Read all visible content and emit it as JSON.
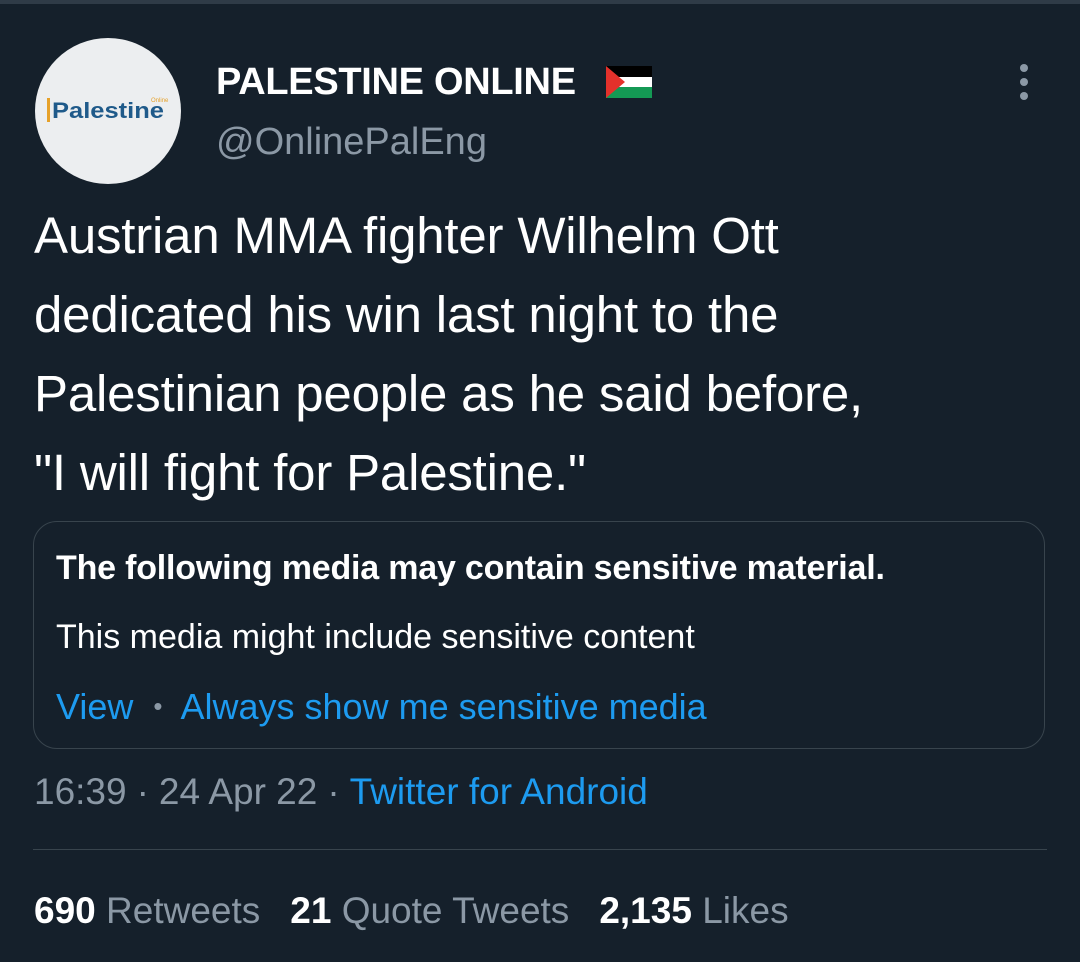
{
  "author": {
    "display_name": "PALESTINE ONLINE",
    "handle": "@OnlinePalEng",
    "avatar_text": "Palestine",
    "avatar_small_text": "Online",
    "badge_icon": "palestine-flag-icon"
  },
  "tweet": {
    "text": "Austrian MMA fighter Wilhelm Ott\ndedicated his win last night to the\nPalestinian people as he said before,\n\"I will fight for Palestine.\""
  },
  "sensitive_notice": {
    "title": "The following media may contain sensitive material.",
    "description": "This media might include sensitive content",
    "view_label": "View",
    "separator": "•",
    "always_show_label": "Always show me sensitive media"
  },
  "meta": {
    "time": "16:39",
    "date": "24 Apr 22",
    "separator": "·",
    "source": "Twitter for Android"
  },
  "stats": {
    "retweets_count": "690",
    "retweets_label": "Retweets",
    "quotes_count": "21",
    "quotes_label": "Quote Tweets",
    "likes_count": "2,135",
    "likes_label": "Likes"
  },
  "colors": {
    "background": "#15202b",
    "text": "#ffffff",
    "secondary_text": "#8b98a5",
    "link": "#1d9bf0",
    "border": "#38444d",
    "flag_black": "#000000",
    "flag_white": "#ffffff",
    "flag_green": "#149954",
    "flag_red": "#e4312b"
  }
}
